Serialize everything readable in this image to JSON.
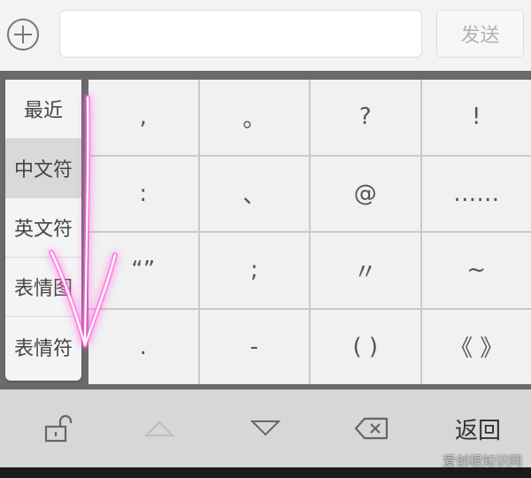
{
  "topbar": {
    "input_value": "",
    "input_placeholder": "",
    "send_label": "发送"
  },
  "categories": [
    {
      "label": "最近",
      "active": false
    },
    {
      "label": "中文符",
      "active": true
    },
    {
      "label": "英文符",
      "active": false
    },
    {
      "label": "表情图",
      "active": false
    },
    {
      "label": "表情符",
      "active": false
    }
  ],
  "symbols": [
    ",",
    "。",
    "?",
    "!",
    ":",
    "、",
    "@",
    "……",
    "“”",
    ";",
    "〃",
    "~",
    ".",
    "-",
    "( )",
    "《 》"
  ],
  "bottombar": {
    "return_label": "返回"
  },
  "watermark": "爱创根知识网",
  "icons": {
    "plus": "plus-circle-icon",
    "unlock": "unlock-icon",
    "up": "triangle-up-icon",
    "down": "triangle-down-icon",
    "backspace": "backspace-icon"
  },
  "colors": {
    "gesture_stroke": "#ff66e0",
    "disabled_text": "#b3b3b3"
  }
}
